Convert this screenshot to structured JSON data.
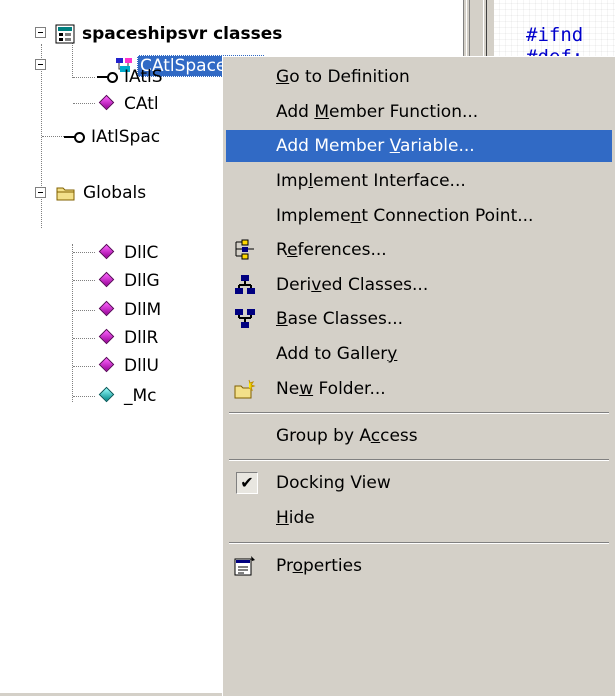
{
  "tree": {
    "root": {
      "label": "spaceshipsvr classes"
    },
    "items": [
      {
        "label": "CAtlSpaceship"
      },
      {
        "label": "IAtlS"
      },
      {
        "label": "CAtl"
      },
      {
        "label": "IAtlSpac"
      },
      {
        "label": "Globals"
      },
      {
        "label": "DllC"
      },
      {
        "label": "DllG"
      },
      {
        "label": "DllM"
      },
      {
        "label": "DllR"
      },
      {
        "label": "DllU"
      },
      {
        "label": "_Mc"
      }
    ]
  },
  "code": {
    "lines": [
      "#ifnd",
      "#def:"
    ]
  },
  "menu": {
    "items": [
      {
        "label": "Go to Definition",
        "accel": "G"
      },
      {
        "label": "Add Member Function...",
        "accel": "M"
      },
      {
        "label": "Add Member Variable...",
        "accel": "V",
        "highlighted": true
      },
      {
        "label": "Implement Interface...",
        "accel": "l"
      },
      {
        "label": "Implement Connection Point...",
        "accel": "n"
      },
      {
        "label": "References...",
        "accel": "e",
        "icon": "references-icon"
      },
      {
        "label": "Derived Classes...",
        "accel": "v",
        "icon": "derived-classes-icon"
      },
      {
        "label": "Base Classes...",
        "accel": "B",
        "icon": "base-classes-icon"
      },
      {
        "label": "Add to Gallery",
        "accel": "y"
      },
      {
        "label": "New Folder...",
        "accel": "w",
        "icon": "new-folder-icon"
      },
      {
        "label": "Group by Access",
        "accel": "c"
      },
      {
        "label": "Docking View",
        "checked": true
      },
      {
        "label": "Hide",
        "accel": "H"
      },
      {
        "label": "Properties",
        "accel": "o",
        "icon": "properties-icon"
      }
    ]
  },
  "colors": {
    "highlight": "#316ac5",
    "face": "#d4d0c8",
    "code_text": "#0000cc"
  }
}
